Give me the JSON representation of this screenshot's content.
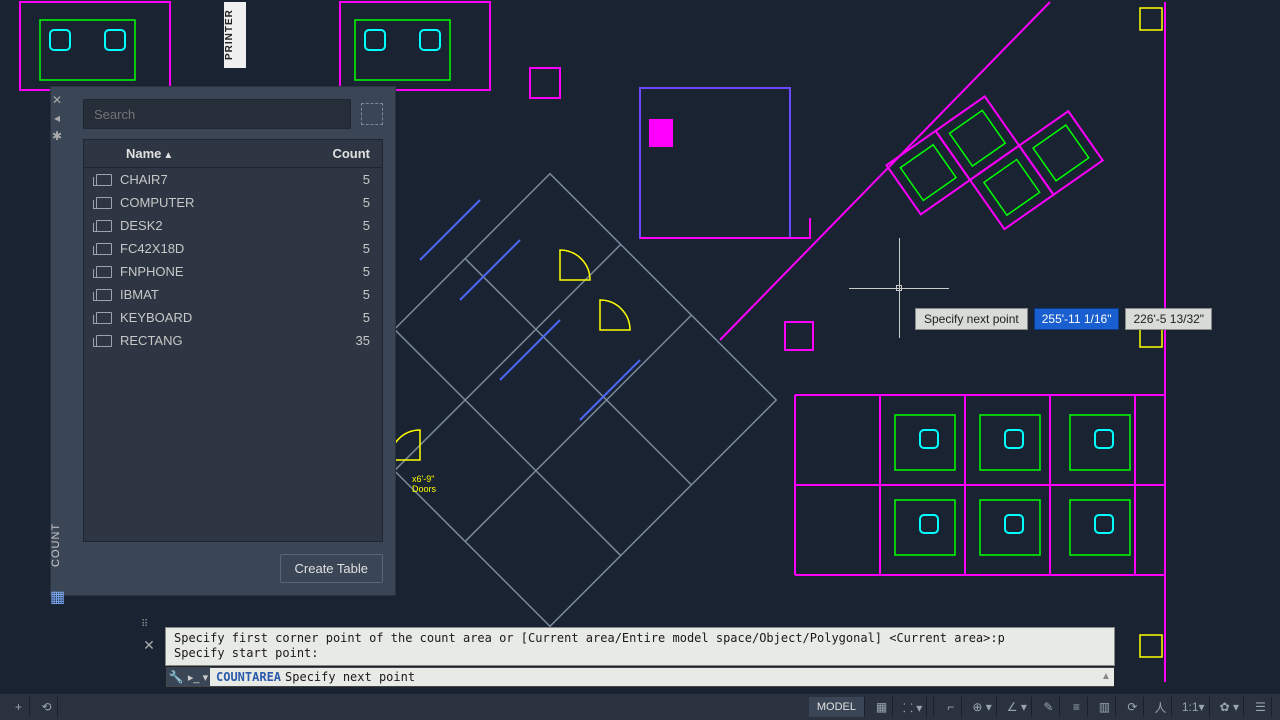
{
  "canvas": {
    "printer_label": "PRINTER",
    "doors_label": "x6'-9\" Doors"
  },
  "panel": {
    "title": "COUNT",
    "search_placeholder": "Search",
    "columns": {
      "name": "Name",
      "count": "Count"
    },
    "items": [
      {
        "name": "CHAIR7",
        "count": "5"
      },
      {
        "name": "COMPUTER",
        "count": "5"
      },
      {
        "name": "DESK2",
        "count": "5"
      },
      {
        "name": "FC42X18D",
        "count": "5"
      },
      {
        "name": "FNPHONE",
        "count": "5"
      },
      {
        "name": "IBMAT",
        "count": "5"
      },
      {
        "name": "KEYBOARD",
        "count": "5"
      },
      {
        "name": "RECTANG",
        "count": "35"
      }
    ],
    "create_table": "Create Table"
  },
  "dynamic_input": {
    "prompt": "Specify next point",
    "x": "255'-11 1/16\"",
    "y": "226'-5 13/32\""
  },
  "command": {
    "history_line1": "Specify first corner point of the count area or [Current area/Entire model space/Object/Polygonal] <Current area>:p",
    "history_line2": "Specify start point:",
    "active_cmd": "COUNTAREA",
    "active_prompt": "Specify next point"
  },
  "status": {
    "model": "MODEL",
    "ratio": "1:1"
  }
}
